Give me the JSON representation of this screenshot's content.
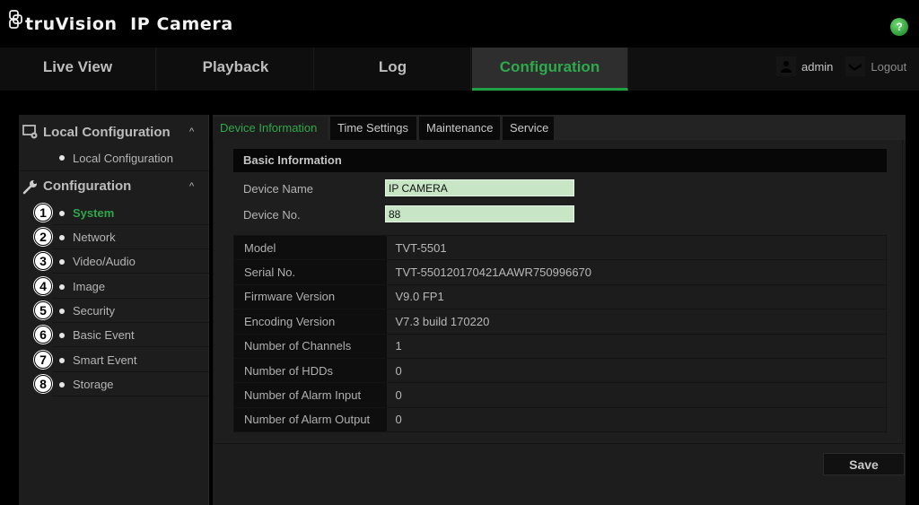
{
  "header": {
    "brand": "truVision  IP Camera",
    "help_label": "?"
  },
  "nav": {
    "tabs": [
      {
        "label": "Live View"
      },
      {
        "label": "Playback"
      },
      {
        "label": "Log"
      },
      {
        "label": "Configuration",
        "active": true
      }
    ],
    "user": "admin",
    "logout": "Logout"
  },
  "sidebar": {
    "local_group": {
      "title": "Local Configuration",
      "items": [
        {
          "label": "Local Configuration"
        }
      ]
    },
    "config_group": {
      "title": "Configuration",
      "items": [
        {
          "badge": "1",
          "label": "System",
          "active": true
        },
        {
          "badge": "2",
          "label": "Network"
        },
        {
          "badge": "3",
          "label": "Video/Audio"
        },
        {
          "badge": "4",
          "label": "Image"
        },
        {
          "badge": "5",
          "label": "Security"
        },
        {
          "badge": "6",
          "label": "Basic Event"
        },
        {
          "badge": "7",
          "label": "Smart Event"
        },
        {
          "badge": "8",
          "label": "Storage"
        }
      ]
    },
    "chevron": "^"
  },
  "content": {
    "tabs": [
      {
        "label": "Device Information",
        "active": true
      },
      {
        "label": "Time Settings"
      },
      {
        "label": "Maintenance"
      },
      {
        "label": "Service"
      }
    ],
    "section_title": "Basic Information",
    "form": {
      "device_name_label": "Device Name",
      "device_name_value": "IP CAMERA",
      "device_no_label": "Device No.",
      "device_no_value": "88"
    },
    "info": [
      {
        "key": "Model",
        "value": "TVT-5501"
      },
      {
        "key": "Serial No.",
        "value": "TVT-550120170421AAWR750996670"
      },
      {
        "key": "Firmware Version",
        "value": "V9.0 FP1"
      },
      {
        "key": "Encoding Version",
        "value": "V7.3 build 170220"
      },
      {
        "key": "Number of Channels",
        "value": "1"
      },
      {
        "key": "Number of HDDs",
        "value": "0"
      },
      {
        "key": "Number of Alarm Input",
        "value": "0"
      },
      {
        "key": "Number of Alarm Output",
        "value": "0"
      }
    ],
    "save_label": "Save"
  },
  "colors": {
    "accent_green": "#2ea84a",
    "input_bg": "#c8e6c6",
    "help_green": "#3aa844"
  }
}
